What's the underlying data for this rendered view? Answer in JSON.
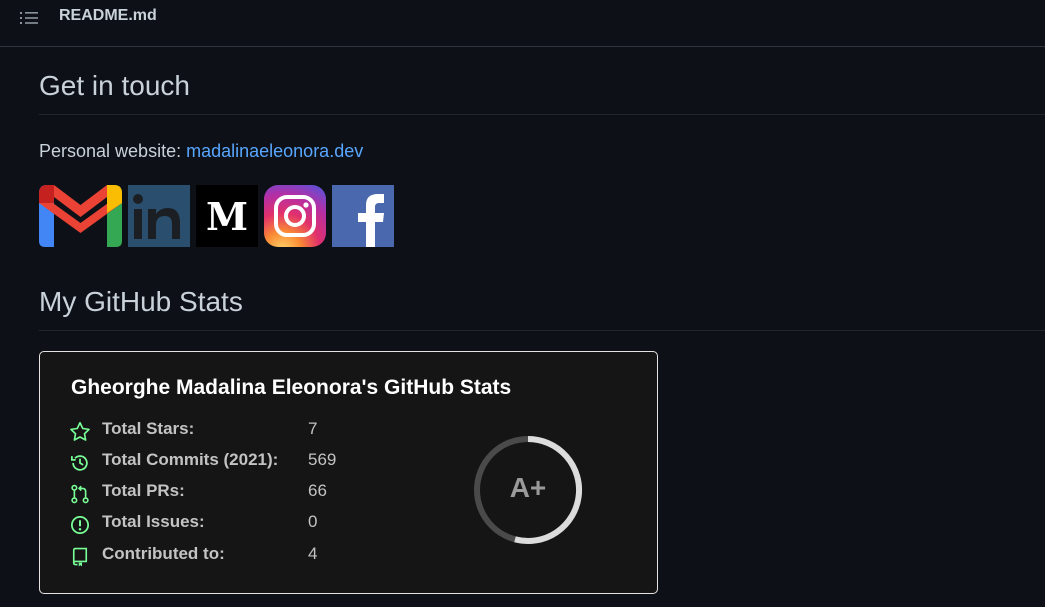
{
  "header": {
    "file_name": "README.md",
    "toc_icon": "list-icon"
  },
  "contact": {
    "heading": "Get in touch",
    "website_label": "Personal website:",
    "website_link": "madalinaeleonora.dev",
    "social_icons": [
      "gmail-icon",
      "linkedin-icon",
      "medium-icon",
      "instagram-icon",
      "facebook-icon"
    ]
  },
  "stats_section": {
    "heading": "My GitHub Stats"
  },
  "stats_card": {
    "title": "Gheorghe Madalina Eleonora's GitHub Stats",
    "rows": [
      {
        "icon": "star-icon",
        "label": "Total Stars:",
        "value": "7"
      },
      {
        "icon": "history-icon",
        "label": "Total Commits (2021):",
        "value": "569"
      },
      {
        "icon": "pull-request-icon",
        "label": "Total PRs:",
        "value": "66"
      },
      {
        "icon": "issue-icon",
        "label": "Total Issues:",
        "value": "0"
      },
      {
        "icon": "repo-icon",
        "label": "Contributed to:",
        "value": "4"
      }
    ],
    "rank": "A+",
    "colors": {
      "icon": "#79ff97",
      "ring": "#dcdcdc",
      "ring_track": "#4a4a4a"
    }
  }
}
